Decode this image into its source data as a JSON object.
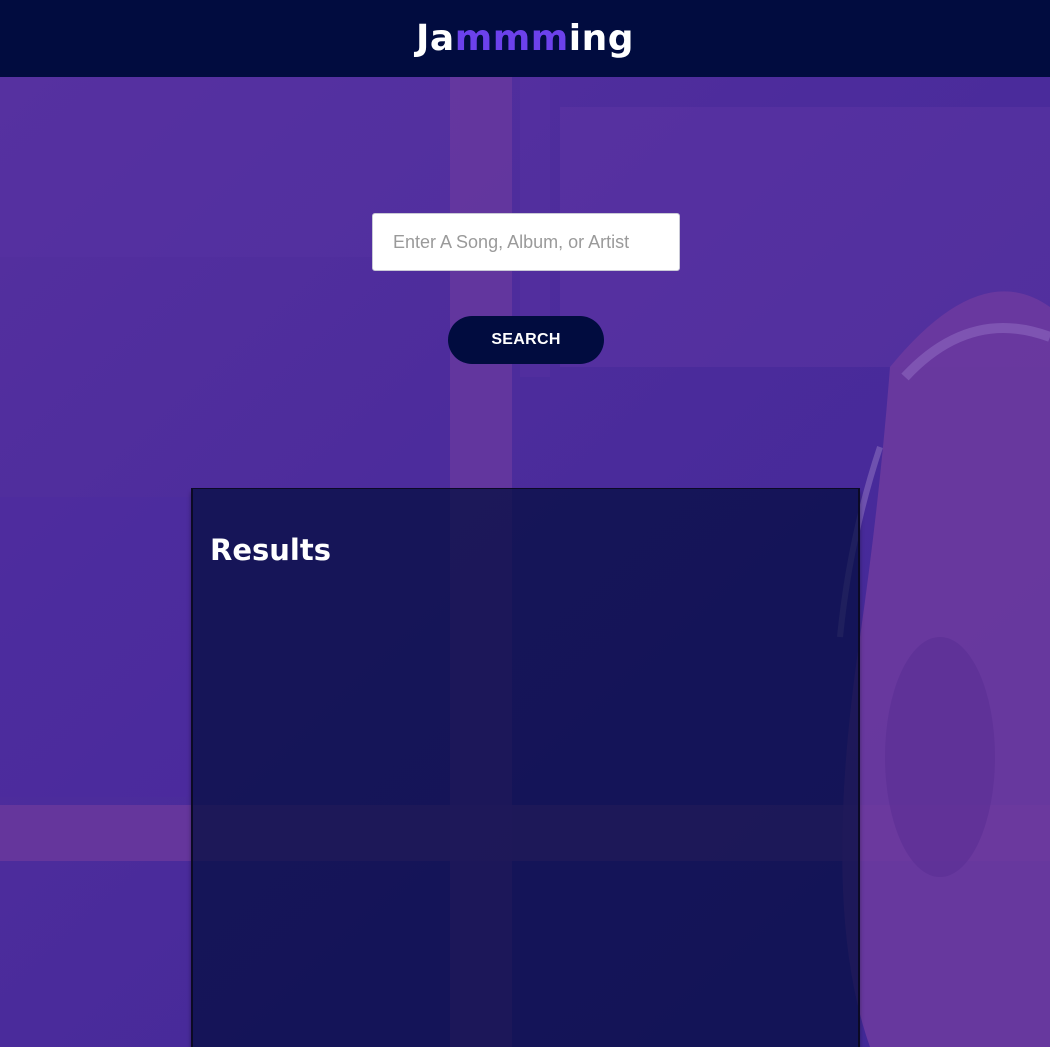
{
  "header": {
    "logo_prefix": "Ja",
    "logo_accent": "mmm",
    "logo_suffix": "ing"
  },
  "search": {
    "placeholder": "Enter A Song, Album, or Artist",
    "value": "",
    "button_label": "SEARCH"
  },
  "results": {
    "title": "Results"
  },
  "colors": {
    "header_bg": "#010c3f",
    "accent": "#6c41ec",
    "button_bg": "#010c3f",
    "background": "#4b2a9a"
  }
}
